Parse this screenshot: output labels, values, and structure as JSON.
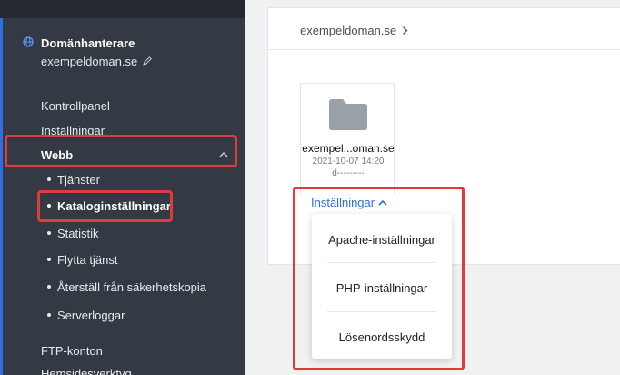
{
  "sidebar": {
    "site_title": "Domänhanterare",
    "site_domain": "exempeldoman.se",
    "nav": {
      "kontrollpanel": "Kontrollpanel",
      "installningar": "Inställningar",
      "webb": "Webb",
      "ftp": "FTP-konton",
      "hemsidesverktyg": "Hemsidesverktyg"
    },
    "webb_items": [
      "Tjänster",
      "Kataloginställningar",
      "Statistik",
      "Flytta tjänst",
      "Återställ från säkerhetskopia",
      "Serverloggar"
    ]
  },
  "main": {
    "breadcrumb": "exempeldoman.se",
    "folder": {
      "name": "exempel...oman.se",
      "date": "2021-10-07 14:20",
      "permissions": "d---------"
    },
    "settings_toggle": "Inställningar",
    "dropdown": [
      "Apache-inställningar",
      "PHP-inställningar",
      "Lösenordsskydd"
    ]
  },
  "colors": {
    "sidebar_bg": "#333a44",
    "accent_blue": "#2e6fe0",
    "highlight_red": "#e0393e"
  }
}
